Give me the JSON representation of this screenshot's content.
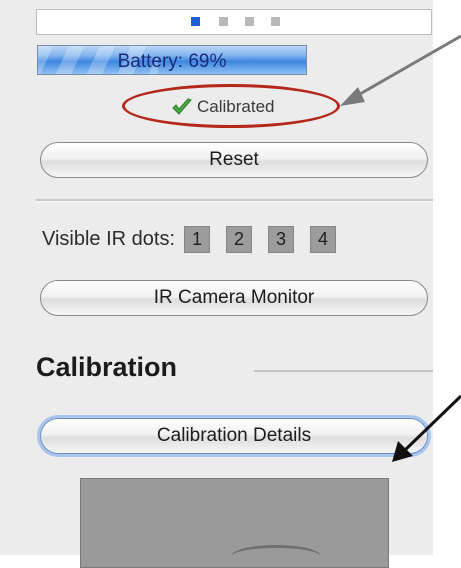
{
  "wiimote": {
    "leds": [
      true,
      false,
      false,
      false
    ],
    "battery": {
      "label": "Battery: 69%",
      "level": 0.69
    },
    "status": {
      "icon": "checkmark-icon",
      "label": "Calibrated"
    },
    "reset_label": "Reset",
    "ir": {
      "label": "Visible IR dots:",
      "dots": [
        "1",
        "2",
        "3",
        "4"
      ]
    },
    "ir_monitor_label": "IR Camera Monitor"
  },
  "calibration": {
    "title": "Calibration",
    "details_label": "Calibration Details"
  },
  "annotations": {
    "highlight_color": "#b5271b",
    "arrow_colors": [
      "#7a7a7a",
      "#111111"
    ]
  }
}
